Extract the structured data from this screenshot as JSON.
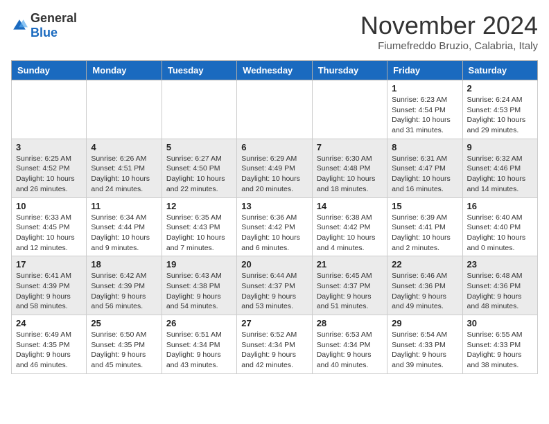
{
  "header": {
    "logo_general": "General",
    "logo_blue": "Blue",
    "month_title": "November 2024",
    "location": "Fiumefreddo Bruzio, Calabria, Italy"
  },
  "columns": [
    "Sunday",
    "Monday",
    "Tuesday",
    "Wednesday",
    "Thursday",
    "Friday",
    "Saturday"
  ],
  "weeks": [
    [
      {
        "day": "",
        "info": ""
      },
      {
        "day": "",
        "info": ""
      },
      {
        "day": "",
        "info": ""
      },
      {
        "day": "",
        "info": ""
      },
      {
        "day": "",
        "info": ""
      },
      {
        "day": "1",
        "info": "Sunrise: 6:23 AM\nSunset: 4:54 PM\nDaylight: 10 hours and 31 minutes."
      },
      {
        "day": "2",
        "info": "Sunrise: 6:24 AM\nSunset: 4:53 PM\nDaylight: 10 hours and 29 minutes."
      }
    ],
    [
      {
        "day": "3",
        "info": "Sunrise: 6:25 AM\nSunset: 4:52 PM\nDaylight: 10 hours and 26 minutes."
      },
      {
        "day": "4",
        "info": "Sunrise: 6:26 AM\nSunset: 4:51 PM\nDaylight: 10 hours and 24 minutes."
      },
      {
        "day": "5",
        "info": "Sunrise: 6:27 AM\nSunset: 4:50 PM\nDaylight: 10 hours and 22 minutes."
      },
      {
        "day": "6",
        "info": "Sunrise: 6:29 AM\nSunset: 4:49 PM\nDaylight: 10 hours and 20 minutes."
      },
      {
        "day": "7",
        "info": "Sunrise: 6:30 AM\nSunset: 4:48 PM\nDaylight: 10 hours and 18 minutes."
      },
      {
        "day": "8",
        "info": "Sunrise: 6:31 AM\nSunset: 4:47 PM\nDaylight: 10 hours and 16 minutes."
      },
      {
        "day": "9",
        "info": "Sunrise: 6:32 AM\nSunset: 4:46 PM\nDaylight: 10 hours and 14 minutes."
      }
    ],
    [
      {
        "day": "10",
        "info": "Sunrise: 6:33 AM\nSunset: 4:45 PM\nDaylight: 10 hours and 12 minutes."
      },
      {
        "day": "11",
        "info": "Sunrise: 6:34 AM\nSunset: 4:44 PM\nDaylight: 10 hours and 9 minutes."
      },
      {
        "day": "12",
        "info": "Sunrise: 6:35 AM\nSunset: 4:43 PM\nDaylight: 10 hours and 7 minutes."
      },
      {
        "day": "13",
        "info": "Sunrise: 6:36 AM\nSunset: 4:42 PM\nDaylight: 10 hours and 6 minutes."
      },
      {
        "day": "14",
        "info": "Sunrise: 6:38 AM\nSunset: 4:42 PM\nDaylight: 10 hours and 4 minutes."
      },
      {
        "day": "15",
        "info": "Sunrise: 6:39 AM\nSunset: 4:41 PM\nDaylight: 10 hours and 2 minutes."
      },
      {
        "day": "16",
        "info": "Sunrise: 6:40 AM\nSunset: 4:40 PM\nDaylight: 10 hours and 0 minutes."
      }
    ],
    [
      {
        "day": "17",
        "info": "Sunrise: 6:41 AM\nSunset: 4:39 PM\nDaylight: 9 hours and 58 minutes."
      },
      {
        "day": "18",
        "info": "Sunrise: 6:42 AM\nSunset: 4:39 PM\nDaylight: 9 hours and 56 minutes."
      },
      {
        "day": "19",
        "info": "Sunrise: 6:43 AM\nSunset: 4:38 PM\nDaylight: 9 hours and 54 minutes."
      },
      {
        "day": "20",
        "info": "Sunrise: 6:44 AM\nSunset: 4:37 PM\nDaylight: 9 hours and 53 minutes."
      },
      {
        "day": "21",
        "info": "Sunrise: 6:45 AM\nSunset: 4:37 PM\nDaylight: 9 hours and 51 minutes."
      },
      {
        "day": "22",
        "info": "Sunrise: 6:46 AM\nSunset: 4:36 PM\nDaylight: 9 hours and 49 minutes."
      },
      {
        "day": "23",
        "info": "Sunrise: 6:48 AM\nSunset: 4:36 PM\nDaylight: 9 hours and 48 minutes."
      }
    ],
    [
      {
        "day": "24",
        "info": "Sunrise: 6:49 AM\nSunset: 4:35 PM\nDaylight: 9 hours and 46 minutes."
      },
      {
        "day": "25",
        "info": "Sunrise: 6:50 AM\nSunset: 4:35 PM\nDaylight: 9 hours and 45 minutes."
      },
      {
        "day": "26",
        "info": "Sunrise: 6:51 AM\nSunset: 4:34 PM\nDaylight: 9 hours and 43 minutes."
      },
      {
        "day": "27",
        "info": "Sunrise: 6:52 AM\nSunset: 4:34 PM\nDaylight: 9 hours and 42 minutes."
      },
      {
        "day": "28",
        "info": "Sunrise: 6:53 AM\nSunset: 4:34 PM\nDaylight: 9 hours and 40 minutes."
      },
      {
        "day": "29",
        "info": "Sunrise: 6:54 AM\nSunset: 4:33 PM\nDaylight: 9 hours and 39 minutes."
      },
      {
        "day": "30",
        "info": "Sunrise: 6:55 AM\nSunset: 4:33 PM\nDaylight: 9 hours and 38 minutes."
      }
    ]
  ]
}
